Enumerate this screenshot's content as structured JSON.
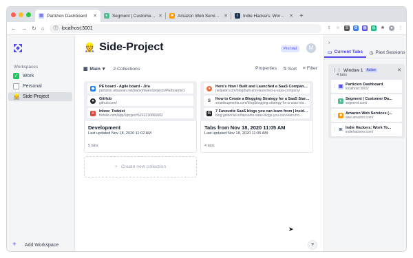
{
  "browser": {
    "tabs": [
      {
        "title": "Partizion Dashboard",
        "icon": "partizion-icon"
      },
      {
        "title": "Segment | Customer Data Platform",
        "icon": "segment-icon"
      },
      {
        "title": "Amazon Web Services (AWS)",
        "icon": "aws-icon"
      },
      {
        "title": "Indie Hackers: Work Together to",
        "icon": "indiehackers-icon"
      }
    ],
    "new_tab": "+",
    "url": "localhost:3001"
  },
  "sidebar": {
    "workspaces_heading": "Workspaces",
    "items": [
      {
        "label": "Work",
        "icon": "✅"
      },
      {
        "label": "Personal",
        "icon": "⬜"
      },
      {
        "label": "Side-Project",
        "icon": "👷"
      }
    ],
    "add_workspace": "Add Workspace"
  },
  "main": {
    "title": "Side-Project",
    "title_emoji": "👷",
    "pro_badge": "Pro trial",
    "avatar_initial": "M",
    "toolbar": {
      "selector": "Main",
      "collections_count": "2 Collections",
      "properties": "Properties",
      "sort": "Sort",
      "filter": "Filter"
    },
    "collections": [
      {
        "name": "Development",
        "updated": "Last updated Nov 18, 2020 11:02 AM",
        "tabs_count": "5 tabs",
        "links": [
          {
            "title": "PE board - Agile board - Jira",
            "url": "partizion.atlassian.net/jira/software/projects/PE/boards/1",
            "icon": "jira-icon",
            "color": "#2684ff",
            "glyph": "◆"
          },
          {
            "title": "GitHub",
            "url": "github.com/",
            "icon": "github-icon",
            "color": "#24292e",
            "glyph": "●"
          },
          {
            "title": "Inbox: Todoist",
            "url": "todoist.com/app/#project%2F2230866002",
            "icon": "todoist-icon",
            "color": "#db4c3f",
            "glyph": "≡"
          }
        ]
      },
      {
        "name": "Tabs from Nov 18, 2020 11:05 AM",
        "updated": "Last updated Nov 18, 2020 11:05 AM",
        "tabs_count": "4 tabs",
        "links": [
          {
            "title": "Here's How I Built and Launched a SaaS Company F...",
            "url": "neilpatel.com/blog/built-and-launched-a-saas-company/",
            "icon": "neilpatel-icon",
            "color": "#f26b3a",
            "glyph": "●"
          },
          {
            "title": "How to Create a Blogging Strategy for a SaaS Startup",
            "url": "smartbugmedia.com/blog/blogging-strategy-for-a-saas-sta...",
            "icon": "smartbug-icon",
            "color": "#333333",
            "glyph": "S"
          },
          {
            "title": "7 Favourite SaaS blogs you can learn from | Inside G...",
            "url": "blog.getsocial.io/favourite-saas-blogs-you-can-learn-fro...",
            "icon": "getsocial-icon",
            "color": "#222222",
            "glyph": "G"
          }
        ]
      }
    ],
    "new_collection": "Create new collection",
    "help": "?"
  },
  "right_panel": {
    "tabs": [
      {
        "label": "Current Tabs",
        "icon": "window-icon"
      },
      {
        "label": "Past Sessions",
        "icon": "history-icon"
      }
    ],
    "window": {
      "title": "Window 1",
      "badge": "Active",
      "tabs_count": "4 tabs",
      "tabs": [
        {
          "title": "Partizion Dashboard",
          "url": "localhost:3001/",
          "icon": "partizion-icon",
          "color": "#c7d2fe",
          "glyph": "▦"
        },
        {
          "title": "Segment | Customer Da...",
          "url": "segment.com/",
          "icon": "segment-icon",
          "color": "#52bd94",
          "glyph": "◐"
        },
        {
          "title": "Amazon Web Services (...",
          "url": "aws.amazon.com/",
          "icon": "aws-icon",
          "color": "#ff9900",
          "glyph": "■"
        },
        {
          "title": "Indie Hackers: Work To...",
          "url": "indiehackers.com/",
          "icon": "indiehackers-icon",
          "color": "#1f364d",
          "glyph": "IH"
        }
      ]
    }
  }
}
